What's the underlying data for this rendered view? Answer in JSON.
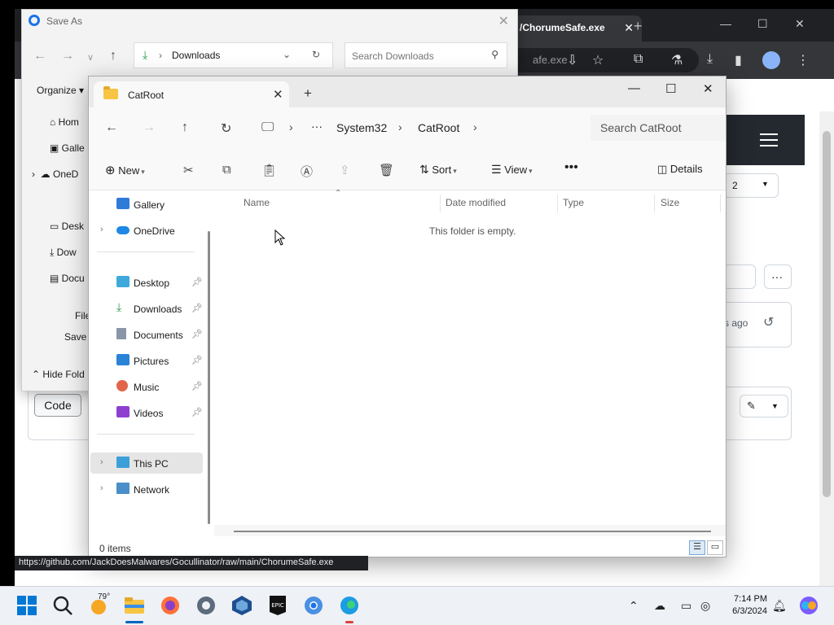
{
  "browser": {
    "active_tab": "/ChorumeSafe.exe",
    "omnibox_text": "afe.exe",
    "status_url": "https://github.com/JackDoesMalwares/Gocullinator/raw/main/ChorumeSafe.exe",
    "code_button": "Code",
    "dropdown_value": "2",
    "time_ago": "s ago"
  },
  "save_as": {
    "title": "Save As",
    "address": "Downloads",
    "search_placeholder": "Search Downloads",
    "organize": "Organize",
    "sidebar": [
      "Hom",
      "Galle",
      "OneD",
      "Desk",
      "Dow",
      "Docu"
    ],
    "file_label": "File",
    "save_label": "Save",
    "hide_folders": "Hide Fold"
  },
  "explorer": {
    "tab_title": "CatRoot",
    "breadcrumb": [
      "System32",
      "CatRoot"
    ],
    "search_placeholder": "Search CatRoot",
    "commands": {
      "new": "New",
      "sort": "Sort",
      "view": "View",
      "details": "Details"
    },
    "nav": {
      "gallery": "Gallery",
      "onedrive": "OneDrive",
      "desktop": "Desktop",
      "downloads": "Downloads",
      "documents": "Documents",
      "pictures": "Pictures",
      "music": "Music",
      "videos": "Videos",
      "this_pc": "This PC",
      "network": "Network"
    },
    "columns": {
      "name": "Name",
      "date_modified": "Date modified",
      "type": "Type",
      "size": "Size"
    },
    "empty_message": "This folder is empty.",
    "status": "0 items"
  },
  "taskbar": {
    "weather_temp": "79°",
    "time": "7:14 PM",
    "date": "6/3/2024"
  },
  "colors": {
    "accent": "#0067c0",
    "folder": "#f8c443",
    "taskbar": "#eef1f6"
  }
}
